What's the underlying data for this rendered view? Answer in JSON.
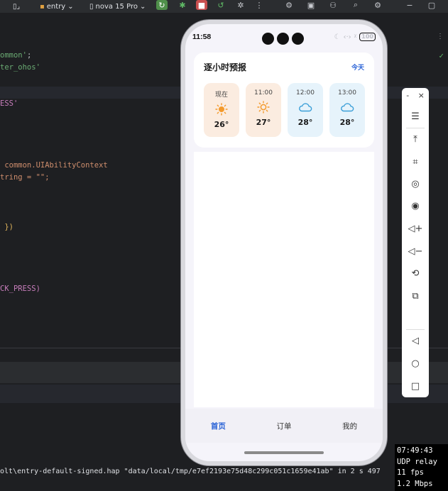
{
  "ide": {
    "toolbar": {
      "module": "entry",
      "device": "nova 15 Pro"
    },
    "code_lines": [
      {
        "prefix": "",
        "text": "ommon'",
        "tail": ";"
      },
      {
        "prefix": "",
        "text": "ter_ohos'",
        "tail": ""
      },
      {
        "prefix": "",
        "text": "ESS'",
        "tail": ""
      },
      {
        "prefix": "",
        "text": " common.UIAbilityContext",
        "tail": ""
      },
      {
        "prefix": "",
        "text": "tring = \"\";",
        "tail": ""
      },
      {
        "prefix": "",
        "text": " })",
        "tail": ""
      },
      {
        "prefix": "",
        "text": "CK_PRESS)",
        "tail": ""
      }
    ],
    "console_line": "olt\\entry-default-signed.hap \"data/local/tmp/e7ef2193e75d48c299c051c1659e41ab\" in 2 s 497"
  },
  "phone": {
    "status": {
      "time": "11:58",
      "battery": "100"
    },
    "card": {
      "title": "逐小时预报",
      "link": "今天",
      "hours": [
        {
          "label": "现在",
          "icon": "sun-icon",
          "temp": "26°",
          "tone": "warm"
        },
        {
          "label": "11:00",
          "icon": "sun-icon",
          "temp": "27°",
          "tone": "warm"
        },
        {
          "label": "12:00",
          "icon": "cloud-icon",
          "temp": "28°",
          "tone": "cool"
        },
        {
          "label": "13:00",
          "icon": "cloud-icon",
          "temp": "28°",
          "tone": "cool"
        }
      ]
    },
    "tabs": [
      {
        "label": "首页",
        "active": true
      },
      {
        "label": "订单",
        "active": false
      },
      {
        "label": "我的",
        "active": false
      }
    ]
  },
  "emulator_toolbar": {
    "minimize": "-",
    "close": "×"
  },
  "stats": {
    "time": "07:49:43",
    "mode": "UDP relay",
    "fps": "11 fps",
    "rate": "1.2 Mbps"
  },
  "colors": {
    "accent": "#2962d6",
    "sun": "#f39a2c",
    "cloud": "#3b9fd8"
  }
}
